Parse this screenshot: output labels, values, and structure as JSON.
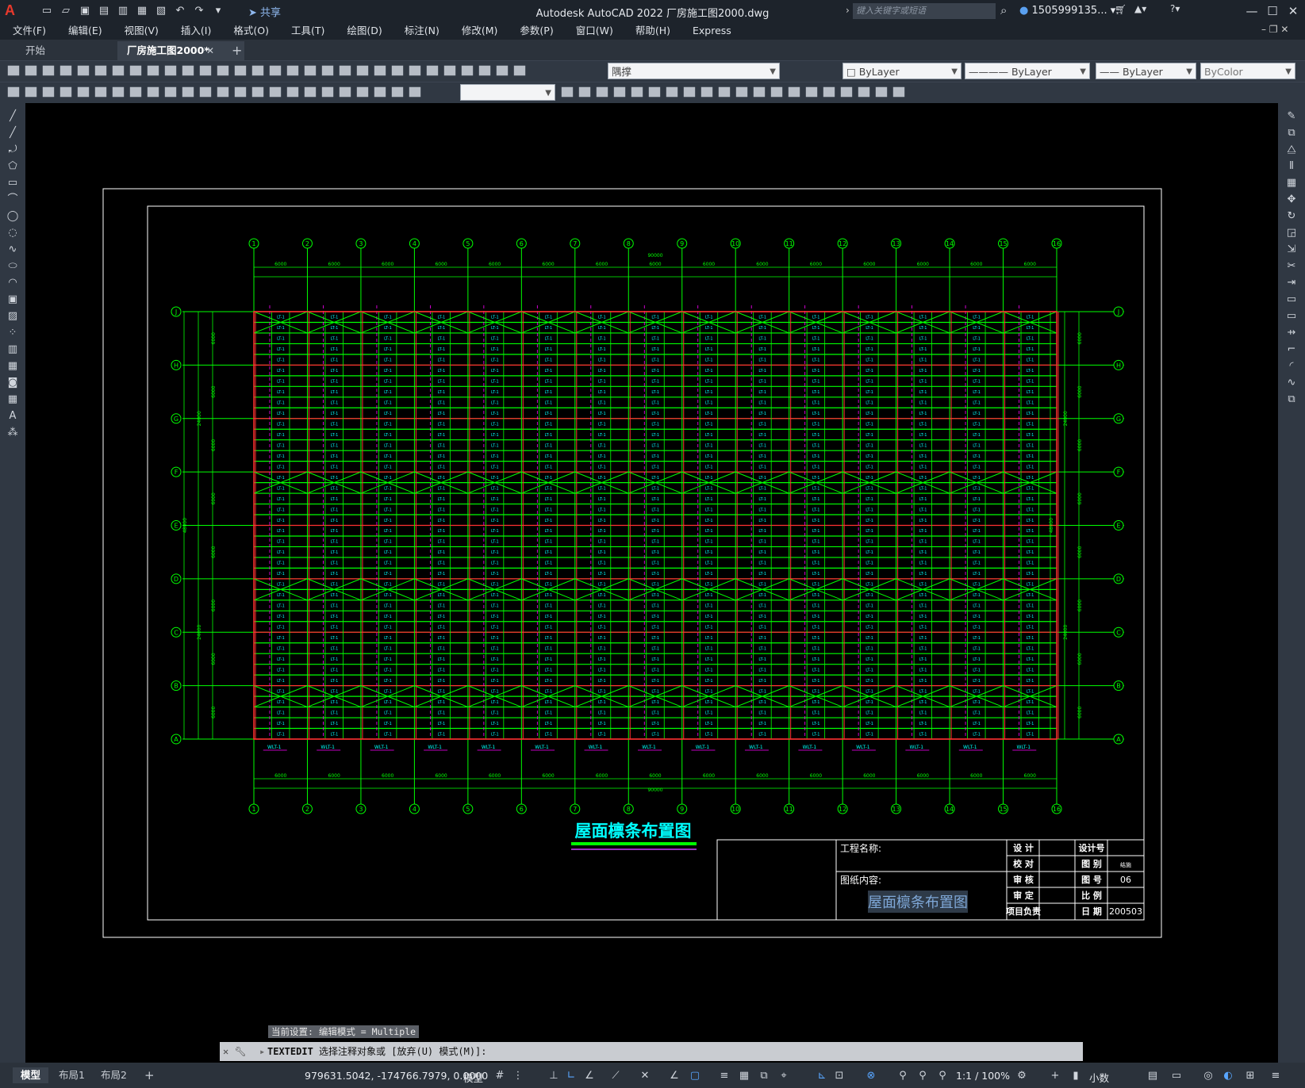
{
  "app": {
    "logo": "A",
    "window_title": "Autodesk AutoCAD 2022    厂房施工图2000.dwg",
    "share_label": "共享",
    "search_placeholder": "键入关键字或短语",
    "user": "1505999135...",
    "icons": [
      "new-icon",
      "open-icon",
      "save-icon",
      "save-as-icon",
      "publish-icon",
      "print-icon",
      "undo-icon",
      "redo-icon"
    ]
  },
  "menubar": [
    "文件(F)",
    "编辑(E)",
    "视图(V)",
    "插入(I)",
    "格式(O)",
    "工具(T)",
    "绘图(D)",
    "标注(N)",
    "修改(M)",
    "参数(P)",
    "窗口(W)",
    "帮助(H)",
    "Express"
  ],
  "tabs": {
    "start": "开始",
    "doc": "厂房施工图2000*"
  },
  "properties": {
    "layer": "隅撑",
    "color": "ByLayer",
    "linetype": "ByLayer",
    "lineweight": "ByLayer",
    "plotstyle": "ByColor"
  },
  "drawing": {
    "title": "屋面檩条布置图",
    "col_axes": [
      "1",
      "2",
      "3",
      "4",
      "5",
      "6",
      "7",
      "8",
      "9",
      "10",
      "11",
      "12",
      "13",
      "14",
      "15",
      "16"
    ],
    "row_axes": [
      "J",
      "H",
      "G",
      "F",
      "E",
      "D",
      "C",
      "B",
      "A"
    ],
    "bay_dim": "6000",
    "total_dim": "90000",
    "left_span": "6000",
    "side_total": "48000",
    "side_half": "24000",
    "purlin_tag": "LT-1",
    "bottom_tag": "WLT-1",
    "titleblock": {
      "project_label": "工程名称:",
      "content_label": "图纸内容:",
      "content_value": "屋面檩条布置图",
      "design": "设  计",
      "check": "校  对",
      "review": "审  核",
      "approve": "审  定",
      "lead": "项目负责",
      "design_no": "设计号",
      "discipline": "图  别",
      "discipline_val": "结施",
      "sheet": "图  号",
      "sheet_val": "06",
      "ratio": "比  例",
      "date": "日  期",
      "date_val": "200503"
    }
  },
  "command": {
    "hint": "当前设置: 编辑模式 = Multiple",
    "name": "TEXTEDIT",
    "prompt": "选择注释对象或 [放弃(U) 模式(M)]:"
  },
  "status": {
    "layouts": [
      "模型",
      "布局1",
      "布局2"
    ],
    "coords": "979631.5042, -174766.7979, 0.0000",
    "model": "模型",
    "scale": "1:1 / 100%",
    "units": "小数"
  }
}
